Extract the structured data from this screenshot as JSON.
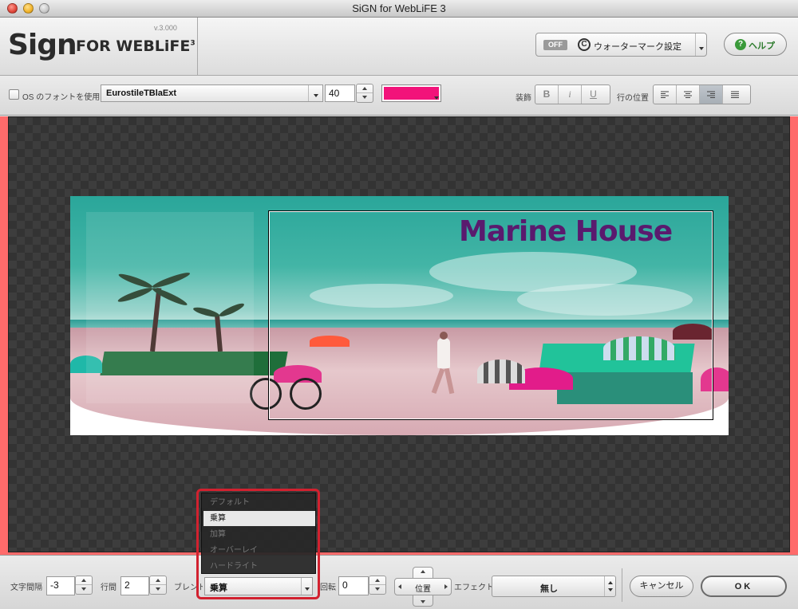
{
  "window": {
    "title": "SiGN for WebLiFE 3"
  },
  "header": {
    "logo_sign": "Sign",
    "logo_rest": "FOR WEBLiFE",
    "logo_superscript": "3",
    "version": "v.3.000",
    "watermark": {
      "toggle": "OFF",
      "icon_char": "C",
      "label": "ウォーターマーク設定"
    },
    "help": {
      "icon_char": "?",
      "label": "ヘルプ"
    }
  },
  "toolbar": {
    "os_font_label": "OS のフォントを使用",
    "font_name": "EurostileTBlaExt",
    "font_size": "40",
    "text_color": "#f2137a",
    "decoration_label": "装飾",
    "bold": "B",
    "italic": "i",
    "underline": "U",
    "line_position_label": "行の位置"
  },
  "canvas": {
    "headline": "Marine House",
    "headline_color": "#5a1a6e",
    "frame_color": "#ff6b6b"
  },
  "blend_menu": {
    "items": [
      "デフォルト",
      "乗算",
      "加算",
      "オーバーレイ",
      "ハードライト"
    ],
    "selected": "乗算"
  },
  "bottombar": {
    "letter_spacing_label": "文字間隔",
    "letter_spacing_value": "-3",
    "line_spacing_label": "行間",
    "line_spacing_value": "2",
    "blend_label": "ブレンド",
    "blend_value": "乗算",
    "rotation_label": "回転",
    "rotation_value": "0",
    "position_label": "位置",
    "effect_label": "エフェクト",
    "effect_value": "無し",
    "cancel": "キャンセル",
    "ok": "OK"
  }
}
